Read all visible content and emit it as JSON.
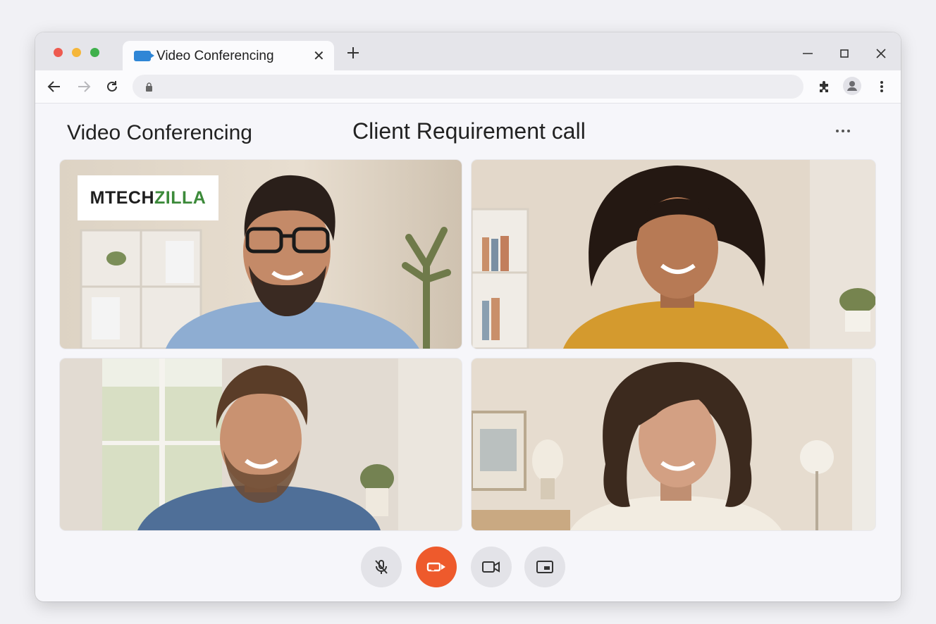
{
  "browser": {
    "tab_title": "Video Conferencing",
    "address": ""
  },
  "app": {
    "title": "Video Conferencing",
    "call_title": "Client Requirement call"
  },
  "participants": [
    {
      "tile": 1,
      "description": "man with glasses, blue shirt",
      "logo": {
        "part1": "MTECH",
        "part2": "ZILLA"
      }
    },
    {
      "tile": 2,
      "description": "woman with curly hair, mustard sweater"
    },
    {
      "tile": 3,
      "description": "man in denim shirt"
    },
    {
      "tile": 4,
      "description": "woman with shoulder-length hair, cream sweater"
    }
  ],
  "controls": [
    "mute-microphone",
    "end-call",
    "camera",
    "screen-share"
  ],
  "colors": {
    "end_call": "#ee5a2c",
    "logo_dark": "#1e1e1e",
    "logo_green": "#3c8a3a",
    "favicon": "#2f86d6"
  }
}
